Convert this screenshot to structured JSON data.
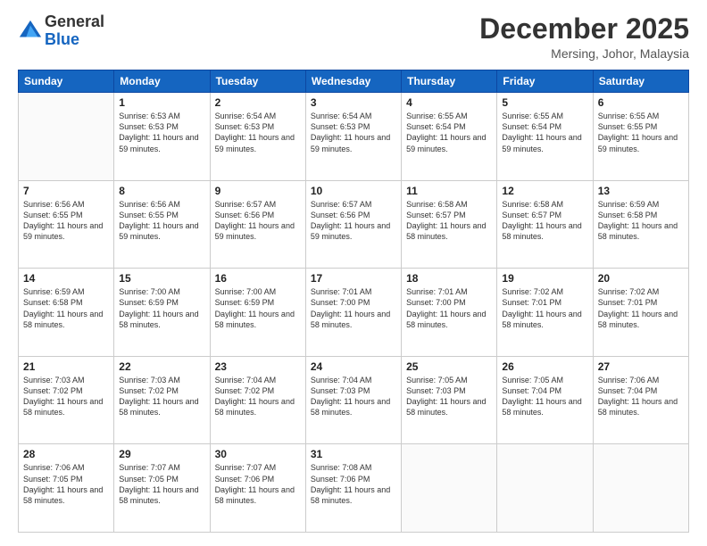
{
  "header": {
    "logo_line1": "General",
    "logo_line2": "Blue",
    "month_year": "December 2025",
    "location": "Mersing, Johor, Malaysia"
  },
  "days_of_week": [
    "Sunday",
    "Monday",
    "Tuesday",
    "Wednesday",
    "Thursday",
    "Friday",
    "Saturday"
  ],
  "weeks": [
    [
      {
        "day": "",
        "sunrise": "",
        "sunset": "",
        "daylight": ""
      },
      {
        "day": "1",
        "sunrise": "Sunrise: 6:53 AM",
        "sunset": "Sunset: 6:53 PM",
        "daylight": "Daylight: 11 hours and 59 minutes."
      },
      {
        "day": "2",
        "sunrise": "Sunrise: 6:54 AM",
        "sunset": "Sunset: 6:53 PM",
        "daylight": "Daylight: 11 hours and 59 minutes."
      },
      {
        "day": "3",
        "sunrise": "Sunrise: 6:54 AM",
        "sunset": "Sunset: 6:53 PM",
        "daylight": "Daylight: 11 hours and 59 minutes."
      },
      {
        "day": "4",
        "sunrise": "Sunrise: 6:55 AM",
        "sunset": "Sunset: 6:54 PM",
        "daylight": "Daylight: 11 hours and 59 minutes."
      },
      {
        "day": "5",
        "sunrise": "Sunrise: 6:55 AM",
        "sunset": "Sunset: 6:54 PM",
        "daylight": "Daylight: 11 hours and 59 minutes."
      },
      {
        "day": "6",
        "sunrise": "Sunrise: 6:55 AM",
        "sunset": "Sunset: 6:55 PM",
        "daylight": "Daylight: 11 hours and 59 minutes."
      }
    ],
    [
      {
        "day": "7",
        "sunrise": "Sunrise: 6:56 AM",
        "sunset": "Sunset: 6:55 PM",
        "daylight": "Daylight: 11 hours and 59 minutes."
      },
      {
        "day": "8",
        "sunrise": "Sunrise: 6:56 AM",
        "sunset": "Sunset: 6:55 PM",
        "daylight": "Daylight: 11 hours and 59 minutes."
      },
      {
        "day": "9",
        "sunrise": "Sunrise: 6:57 AM",
        "sunset": "Sunset: 6:56 PM",
        "daylight": "Daylight: 11 hours and 59 minutes."
      },
      {
        "day": "10",
        "sunrise": "Sunrise: 6:57 AM",
        "sunset": "Sunset: 6:56 PM",
        "daylight": "Daylight: 11 hours and 59 minutes."
      },
      {
        "day": "11",
        "sunrise": "Sunrise: 6:58 AM",
        "sunset": "Sunset: 6:57 PM",
        "daylight": "Daylight: 11 hours and 58 minutes."
      },
      {
        "day": "12",
        "sunrise": "Sunrise: 6:58 AM",
        "sunset": "Sunset: 6:57 PM",
        "daylight": "Daylight: 11 hours and 58 minutes."
      },
      {
        "day": "13",
        "sunrise": "Sunrise: 6:59 AM",
        "sunset": "Sunset: 6:58 PM",
        "daylight": "Daylight: 11 hours and 58 minutes."
      }
    ],
    [
      {
        "day": "14",
        "sunrise": "Sunrise: 6:59 AM",
        "sunset": "Sunset: 6:58 PM",
        "daylight": "Daylight: 11 hours and 58 minutes."
      },
      {
        "day": "15",
        "sunrise": "Sunrise: 7:00 AM",
        "sunset": "Sunset: 6:59 PM",
        "daylight": "Daylight: 11 hours and 58 minutes."
      },
      {
        "day": "16",
        "sunrise": "Sunrise: 7:00 AM",
        "sunset": "Sunset: 6:59 PM",
        "daylight": "Daylight: 11 hours and 58 minutes."
      },
      {
        "day": "17",
        "sunrise": "Sunrise: 7:01 AM",
        "sunset": "Sunset: 7:00 PM",
        "daylight": "Daylight: 11 hours and 58 minutes."
      },
      {
        "day": "18",
        "sunrise": "Sunrise: 7:01 AM",
        "sunset": "Sunset: 7:00 PM",
        "daylight": "Daylight: 11 hours and 58 minutes."
      },
      {
        "day": "19",
        "sunrise": "Sunrise: 7:02 AM",
        "sunset": "Sunset: 7:01 PM",
        "daylight": "Daylight: 11 hours and 58 minutes."
      },
      {
        "day": "20",
        "sunrise": "Sunrise: 7:02 AM",
        "sunset": "Sunset: 7:01 PM",
        "daylight": "Daylight: 11 hours and 58 minutes."
      }
    ],
    [
      {
        "day": "21",
        "sunrise": "Sunrise: 7:03 AM",
        "sunset": "Sunset: 7:02 PM",
        "daylight": "Daylight: 11 hours and 58 minutes."
      },
      {
        "day": "22",
        "sunrise": "Sunrise: 7:03 AM",
        "sunset": "Sunset: 7:02 PM",
        "daylight": "Daylight: 11 hours and 58 minutes."
      },
      {
        "day": "23",
        "sunrise": "Sunrise: 7:04 AM",
        "sunset": "Sunset: 7:02 PM",
        "daylight": "Daylight: 11 hours and 58 minutes."
      },
      {
        "day": "24",
        "sunrise": "Sunrise: 7:04 AM",
        "sunset": "Sunset: 7:03 PM",
        "daylight": "Daylight: 11 hours and 58 minutes."
      },
      {
        "day": "25",
        "sunrise": "Sunrise: 7:05 AM",
        "sunset": "Sunset: 7:03 PM",
        "daylight": "Daylight: 11 hours and 58 minutes."
      },
      {
        "day": "26",
        "sunrise": "Sunrise: 7:05 AM",
        "sunset": "Sunset: 7:04 PM",
        "daylight": "Daylight: 11 hours and 58 minutes."
      },
      {
        "day": "27",
        "sunrise": "Sunrise: 7:06 AM",
        "sunset": "Sunset: 7:04 PM",
        "daylight": "Daylight: 11 hours and 58 minutes."
      }
    ],
    [
      {
        "day": "28",
        "sunrise": "Sunrise: 7:06 AM",
        "sunset": "Sunset: 7:05 PM",
        "daylight": "Daylight: 11 hours and 58 minutes."
      },
      {
        "day": "29",
        "sunrise": "Sunrise: 7:07 AM",
        "sunset": "Sunset: 7:05 PM",
        "daylight": "Daylight: 11 hours and 58 minutes."
      },
      {
        "day": "30",
        "sunrise": "Sunrise: 7:07 AM",
        "sunset": "Sunset: 7:06 PM",
        "daylight": "Daylight: 11 hours and 58 minutes."
      },
      {
        "day": "31",
        "sunrise": "Sunrise: 7:08 AM",
        "sunset": "Sunset: 7:06 PM",
        "daylight": "Daylight: 11 hours and 58 minutes."
      },
      {
        "day": "",
        "sunrise": "",
        "sunset": "",
        "daylight": ""
      },
      {
        "day": "",
        "sunrise": "",
        "sunset": "",
        "daylight": ""
      },
      {
        "day": "",
        "sunrise": "",
        "sunset": "",
        "daylight": ""
      }
    ]
  ]
}
